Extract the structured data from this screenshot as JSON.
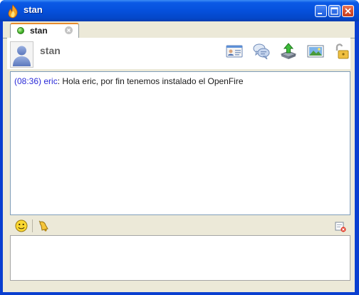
{
  "window": {
    "title": "stan"
  },
  "tabs": [
    {
      "label": "stan",
      "status": "available"
    }
  ],
  "contact": {
    "name": "stan"
  },
  "header_icons": [
    "profile-card-icon",
    "chat-bubbles-icon",
    "send-file-icon",
    "send-image-icon",
    "unlock-icon"
  ],
  "transcript": {
    "messages": [
      {
        "time": "(08:36)",
        "sender": "eric",
        "separator": ": ",
        "text": "Hola eric, por fin tenemos instalado el OpenFire"
      }
    ]
  },
  "composer": {
    "value": ""
  },
  "colors": {
    "titlebar": "#0550dc",
    "client_bg": "#ece9d8",
    "tab_accent": "#e68b2c",
    "message_meta": "#2a2ad8"
  }
}
